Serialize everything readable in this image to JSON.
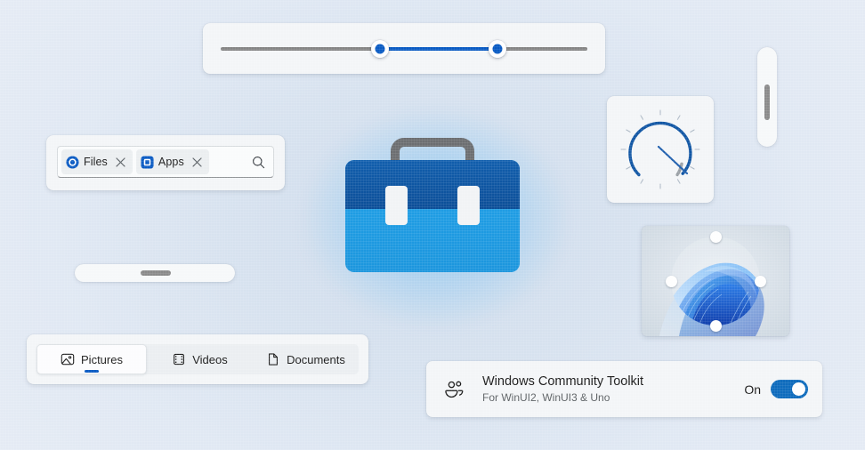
{
  "background": {
    "color": "#e1e9f4",
    "accent": "#0a5bc4"
  },
  "range_slider": {
    "name": "RangeSelector",
    "min_label": "",
    "max_label": "",
    "low_value": 44,
    "high_value": 76,
    "track_color": "#868686",
    "fill_color": "#0a5bc4"
  },
  "token_box": {
    "placeholder": "",
    "value": "",
    "search_icon": "search-icon",
    "tokens": [
      {
        "label": "Files",
        "icon": "circle-outline-icon",
        "close_icon": "close-icon"
      },
      {
        "label": "Apps",
        "icon": "square-outline-icon",
        "close_icon": "close-icon"
      }
    ]
  },
  "logo": {
    "name": "toolkit-toolbox-logo",
    "handle_color": "#6d6f72",
    "top_color": "#0d52a0",
    "bottom_color": "#1f9ee6",
    "latch_color": "#f2f4f6"
  },
  "gauge": {
    "name": "RadialGauge",
    "value": 78,
    "minimum": 0,
    "maximum": 100,
    "arc_color": "#1257a5",
    "trail_color": "#9aa0a6",
    "needle_color": "#1f5fae",
    "tick_count": 12
  },
  "vertical_scrollbar": {
    "orientation": "vertical",
    "thumb_color": "#8b8b8b",
    "position_percent": 40
  },
  "horizontal_scrollbar": {
    "orientation": "horizontal",
    "thumb_color": "#8b8b8b",
    "position_percent": 45
  },
  "cropper": {
    "name": "ImageCropper",
    "shape": "circle",
    "handles": 4,
    "image_alt": "windows-11-bloom-wallpaper"
  },
  "segmented": {
    "selected_index": 0,
    "items": [
      {
        "label": "Pictures",
        "icon": "picture-icon",
        "selected": true
      },
      {
        "label": "Videos",
        "icon": "film-icon",
        "selected": false
      },
      {
        "label": "Documents",
        "icon": "document-icon",
        "selected": false
      }
    ]
  },
  "settings_card": {
    "icon": "people-community-icon",
    "title": "Windows Community Toolkit",
    "subtitle": "For WinUI2, WinUI3 & Uno",
    "toggle_label": "On",
    "toggle_on": true,
    "toggle_color": "#0f6cbd"
  }
}
